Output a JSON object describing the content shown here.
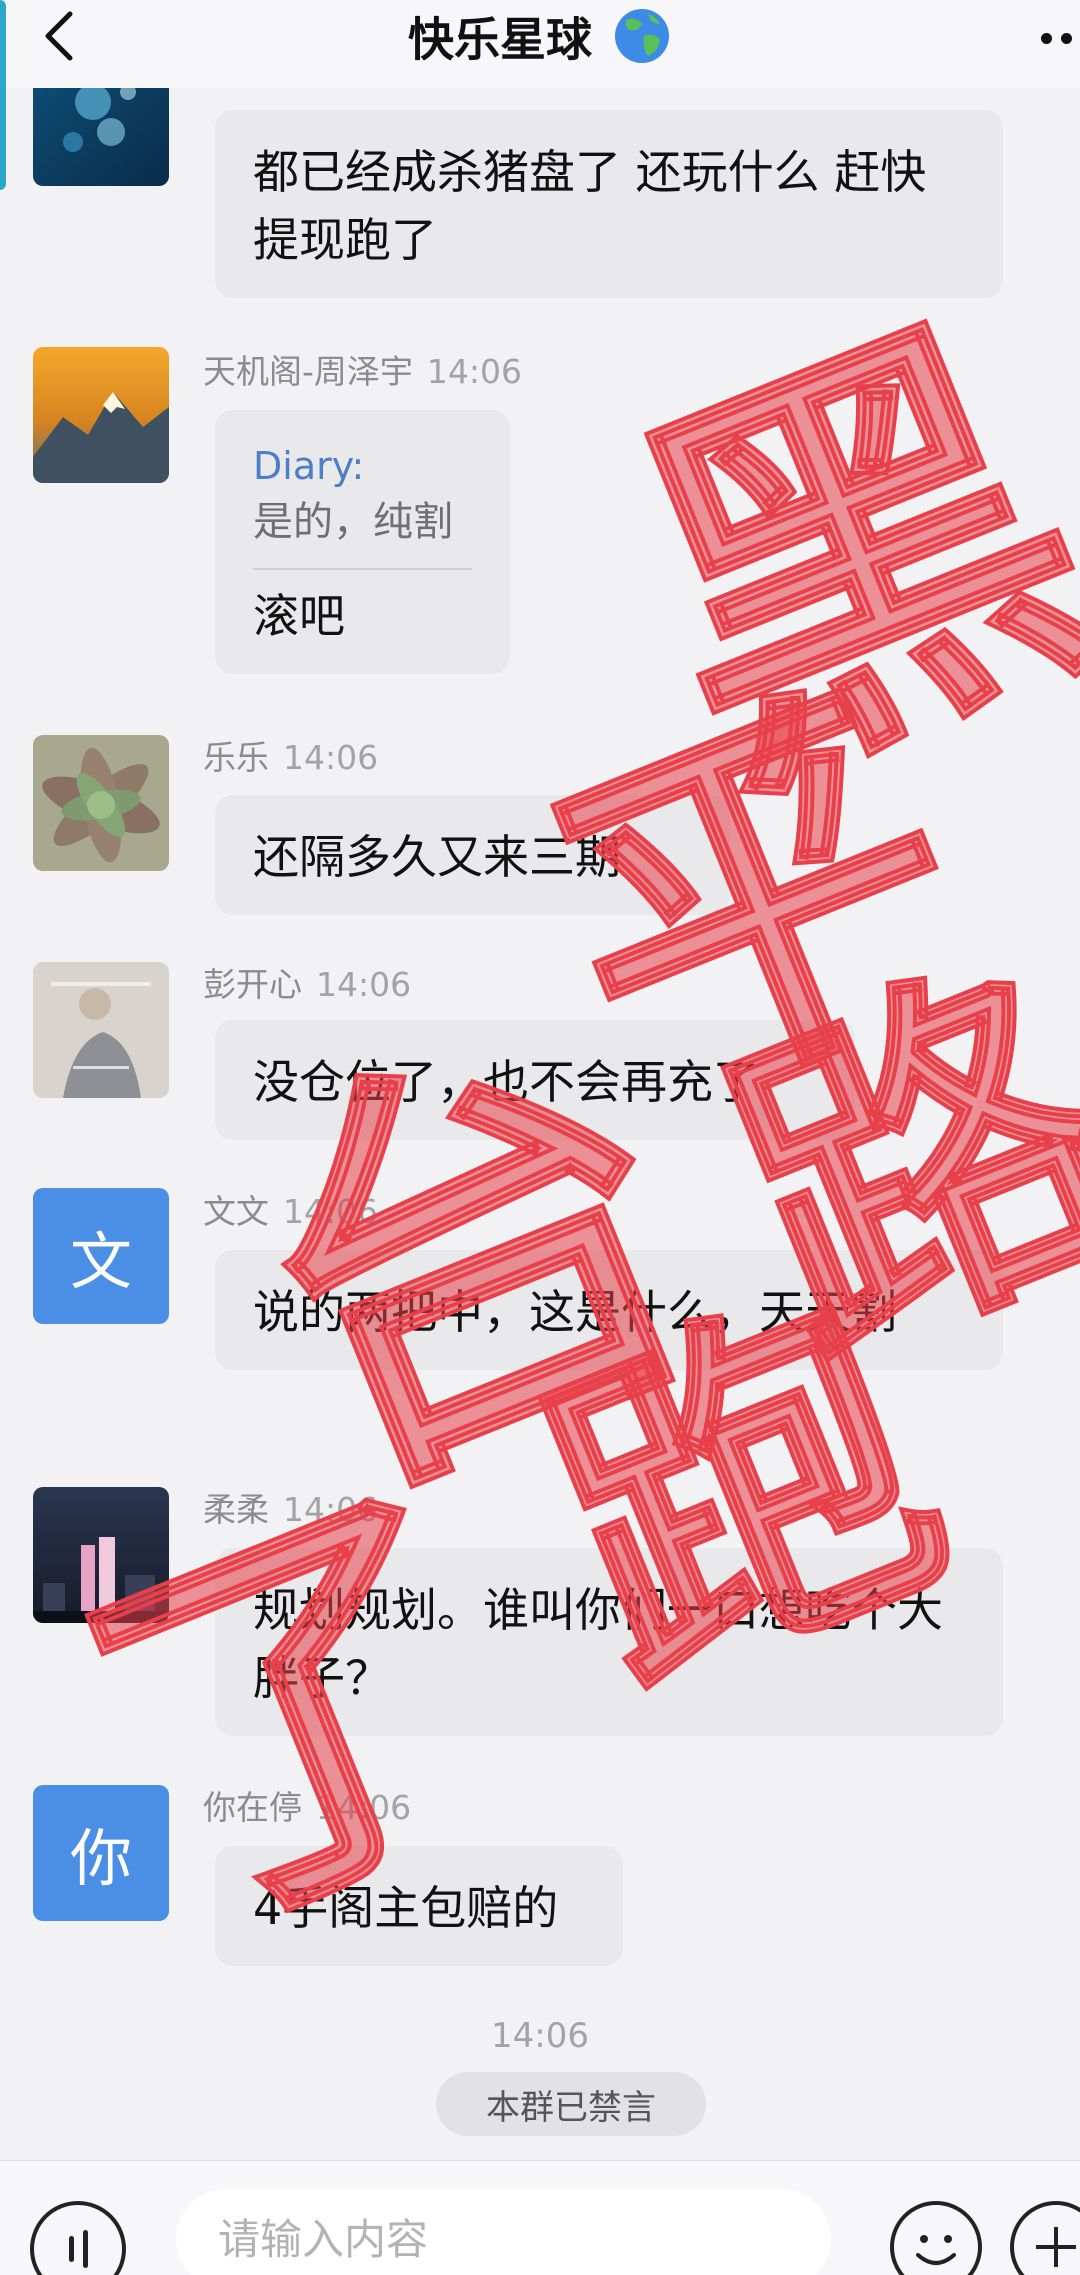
{
  "header": {
    "title": "快乐星球",
    "title_emoji": "globe-icon",
    "back_icon": "back-arrow-icon",
    "more_icon": "more-dots-icon"
  },
  "messages": [
    {
      "sender": "",
      "time": "",
      "text": "都已经成杀猪盘了 还玩什么 赶快提现跑了",
      "avatar": "ocean-photo"
    },
    {
      "sender": "天机阁-周泽宇",
      "time": "14:06",
      "quote_name": "Diary:",
      "quote_text": "是的，纯割",
      "text": "滚吧",
      "avatar": "mountain-photo"
    },
    {
      "sender": "乐乐",
      "time": "14:06",
      "text": "还隔多久又来三期",
      "avatar": "succulent-photo"
    },
    {
      "sender": "彭开心",
      "time": "14:06",
      "text": "没仓位了，也不会再充了",
      "avatar": "person-photo"
    },
    {
      "sender": "文文",
      "time": "14:06",
      "text": "说的两把中，这是什么，天天割",
      "avatar_letter": "文"
    },
    {
      "sender": "柔柔",
      "time": "14:06",
      "text": "规划规划。谁叫你们一口想吃个大胖子？",
      "avatar": "city-night-photo"
    },
    {
      "sender": "你在停",
      "time": "14:06",
      "text": "4手阁主包赔的",
      "avatar_letter": "你"
    }
  ],
  "system": {
    "time": "14:06",
    "notice": "本群已禁言"
  },
  "input": {
    "placeholder": "请输入内容",
    "voice_icon": "voice-icon",
    "emoji_icon": "emoji-icon",
    "plus_icon": "plus-icon"
  },
  "watermark": {
    "text": "黑平台跑路了",
    "color": "#e8404a"
  }
}
